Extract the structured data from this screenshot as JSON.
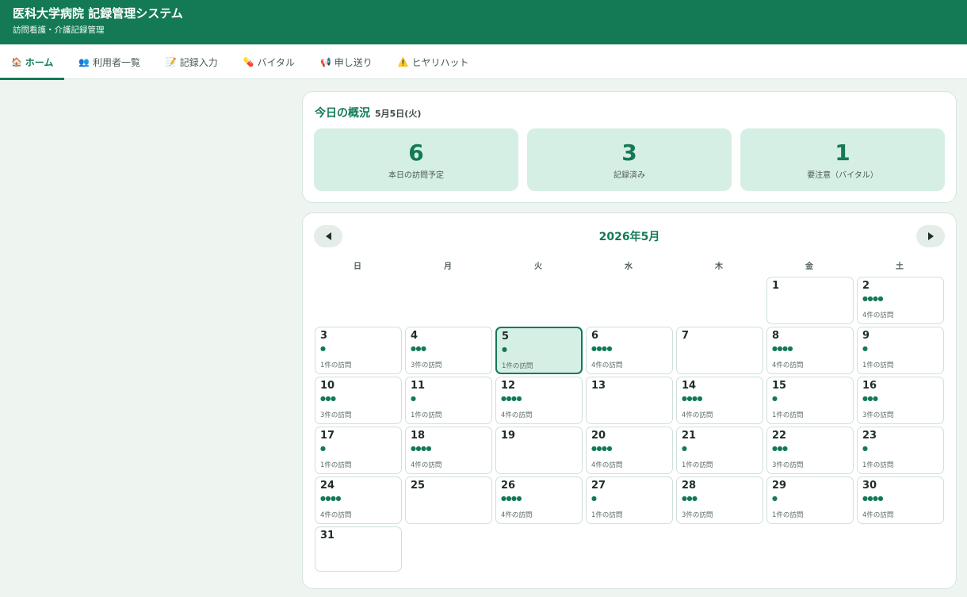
{
  "header": {
    "title": "医科大学病院 記録管理システム",
    "subtitle": "訪問看護・介護記録管理"
  },
  "nav": {
    "tabs": [
      {
        "icon": "🏠",
        "icon_name": "home-icon",
        "label": "ホーム",
        "active": true
      },
      {
        "icon": "👥",
        "icon_name": "users-icon",
        "label": "利用者一覧",
        "active": false
      },
      {
        "icon": "📝",
        "icon_name": "memo-icon",
        "label": "記録入力",
        "active": false
      },
      {
        "icon": "💊",
        "icon_name": "pill-icon",
        "label": "バイタル",
        "active": false
      },
      {
        "icon": "📢",
        "icon_name": "megaphone-icon",
        "label": "申し送り",
        "active": false
      },
      {
        "icon": "⚠️",
        "icon_name": "warning-icon",
        "label": "ヒヤリハット",
        "active": false
      }
    ]
  },
  "summary": {
    "heading": "今日の概況",
    "date": "5月5日(火)",
    "stats": [
      {
        "value": "6",
        "label": "本日の訪問予定"
      },
      {
        "value": "3",
        "label": "記録済み"
      },
      {
        "value": "1",
        "label": "要注意（バイタル）"
      }
    ]
  },
  "calendar": {
    "month_label": "2026年5月",
    "weekdays": [
      "日",
      "月",
      "火",
      "水",
      "木",
      "金",
      "土"
    ],
    "first_weekday_index": 5,
    "today": 5,
    "visit_suffix": "件の訪問",
    "days": [
      {
        "day": "1",
        "visits": 0
      },
      {
        "day": "2",
        "visits": 4
      },
      {
        "day": "3",
        "visits": 1
      },
      {
        "day": "4",
        "visits": 3
      },
      {
        "day": "5",
        "visits": 1
      },
      {
        "day": "6",
        "visits": 4
      },
      {
        "day": "7",
        "visits": 0
      },
      {
        "day": "8",
        "visits": 4
      },
      {
        "day": "9",
        "visits": 1
      },
      {
        "day": "10",
        "visits": 3
      },
      {
        "day": "11",
        "visits": 1
      },
      {
        "day": "12",
        "visits": 4
      },
      {
        "day": "13",
        "visits": 0
      },
      {
        "day": "14",
        "visits": 4
      },
      {
        "day": "15",
        "visits": 1
      },
      {
        "day": "16",
        "visits": 3
      },
      {
        "day": "17",
        "visits": 1
      },
      {
        "day": "18",
        "visits": 4
      },
      {
        "day": "19",
        "visits": 0
      },
      {
        "day": "20",
        "visits": 4
      },
      {
        "day": "21",
        "visits": 1
      },
      {
        "day": "22",
        "visits": 3
      },
      {
        "day": "23",
        "visits": 1
      },
      {
        "day": "24",
        "visits": 4
      },
      {
        "day": "25",
        "visits": 0
      },
      {
        "day": "26",
        "visits": 4
      },
      {
        "day": "27",
        "visits": 1
      },
      {
        "day": "28",
        "visits": 3
      },
      {
        "day": "29",
        "visits": 1
      },
      {
        "day": "30",
        "visits": 4
      },
      {
        "day": "31",
        "visits": 0
      }
    ]
  },
  "colors": {
    "brand": "#137a55",
    "accent_light": "#d6efe5",
    "background": "#eef5f1"
  }
}
